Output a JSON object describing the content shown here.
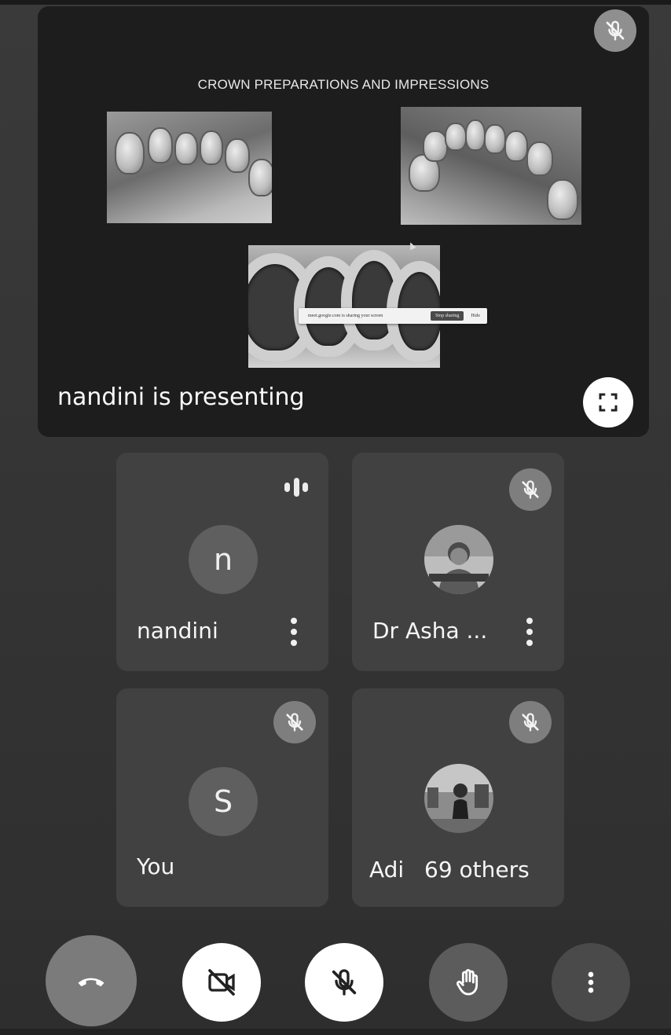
{
  "presentation": {
    "slide_title": "CROWN PREPARATIONS AND IMPRESSIONS",
    "share_bar": {
      "message": "meet.google.com is sharing your screen",
      "stop_label": "Stop sharing",
      "hide_label": "Hide"
    },
    "presenting_label": "nandini is presenting",
    "icons": {
      "mic": "mic-off-icon",
      "fullscreen": "fullscreen-icon"
    }
  },
  "participants": [
    {
      "name": "nandini",
      "avatar_letter": "n",
      "status_icon": "speaking-indicator-icon"
    },
    {
      "name": "Dr Asha ...",
      "avatar": "profile-photo",
      "status_icon": "mic-off-icon"
    },
    {
      "name": "You",
      "avatar_letter": "S",
      "status_icon": "mic-off-icon"
    },
    {
      "name": "Adi",
      "avatar": "profile-photo",
      "overlay_text": "69 others",
      "status_icon": "mic-off-icon"
    }
  ],
  "controls": {
    "end_call": "end-call-icon",
    "camera": "camera-off-icon",
    "mic": "mic-off-icon",
    "raise_hand": "raise-hand-icon",
    "more": "more-options-icon"
  },
  "colors": {
    "background": "#383838",
    "tile": "#414141",
    "presentation_bg": "#1d1d1d",
    "control_light": "#ffffff"
  }
}
